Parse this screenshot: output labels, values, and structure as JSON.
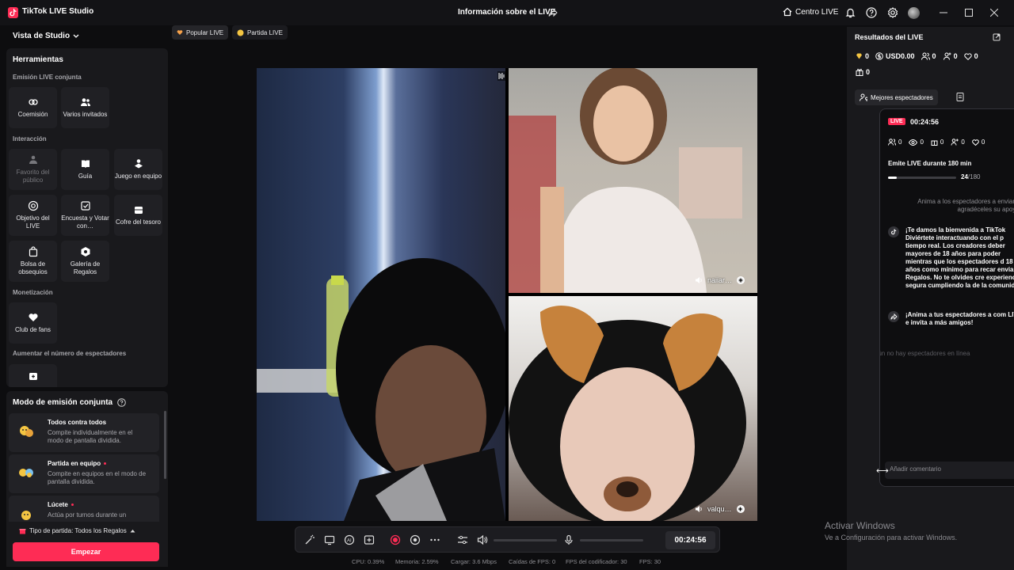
{
  "titlebar": {
    "app_title": "TikTok LIVE Studio",
    "window_title": "Información sobre el LIVE",
    "centro_label": "Centro LIVE"
  },
  "left": {
    "studio_view": "Vista de Studio",
    "tools_title": "Herramientas",
    "sections": {
      "joint": "Emisión LIVE conjunta",
      "interaction": "Interacción",
      "monetization": "Monetización",
      "viewers": "Aumentar el número de espectadores"
    },
    "tools": {
      "comision": "Coemisión",
      "varios": "Varios invitados",
      "favorito": "Favorito del público",
      "guia": "Guía",
      "juego": "Juego en equipo",
      "objetivo": "Objetivo del LIVE",
      "encuesta": "Encuesta y Votar con…",
      "cofre": "Cofre del tesoro",
      "bolsa": "Bolsa de obsequios",
      "galeria": "Galería de Regalos",
      "club": "Club de fans"
    },
    "mode_title": "Modo de emisión conjunta",
    "modes": [
      {
        "title": "Todos contra todos",
        "desc": "Compite individualmente en el modo de pantalla dividida."
      },
      {
        "title": "Partida en equipo",
        "desc": "Compite en equipos en el modo de pantalla dividida."
      },
      {
        "title": "Lúcete",
        "desc": "Actúa por turnos durante un"
      }
    ],
    "party_type": "Tipo de partida: Todos los Regalos",
    "start_button": "Empezar"
  },
  "center": {
    "chips": [
      "Popular LIVE",
      "Partida LIVE"
    ],
    "guests": [
      "naiiar…",
      "valqu…"
    ],
    "timer": "00:24:56",
    "stats": {
      "cpu": "CPU:  0.39%",
      "mem": "Memoria:  2.59%",
      "load": "Cargar:  3.6 Mbps",
      "drops": "Caídas de FPS:  0",
      "enc": "FPS del codificador:  30",
      "fps": "FPS:  30"
    }
  },
  "right": {
    "title": "Resultados del LIVE",
    "metrics": {
      "diamonds": "0",
      "usd": "USD0.00",
      "viewers": "0",
      "new_followers": "0",
      "likes": "0",
      "gifts": "0"
    },
    "best_viewers_tab": "Mejores espectadores",
    "popup": {
      "live_badge": "LIVE",
      "time": "00:24:56",
      "metrics": [
        "0",
        "0",
        "0",
        "0",
        "0"
      ],
      "goal": "Emite LIVE durante 180 min",
      "progress_value": "24",
      "progress_max": "/180",
      "progress_fraction": 0.133,
      "hint": "Anima a los espectadores a enviar R agradéceles su apoyo.",
      "msg1": "¡Te damos la bienvenida a TikTok Diviértete interactuando con el p tiempo real. Los creadores deber mayores de 18 años para poder mientras que los espectadores d 18 años como mínimo para recar enviar Regalos. No te olvides cre experiencia segura cumpliendo la de la comunidad.",
      "msg2": "¡Anima a tus espectadores a com LIVE e invita a más amigos!",
      "no_viewers": "Aún no hay espectadores en línea",
      "comment_placeholder": "Añadir comentario"
    }
  },
  "watermark": {
    "line1": "Activar Windows",
    "line2": "Ve a Configuración para activar Windows."
  },
  "colors": {
    "accent": "#fe2c55",
    "bg": "#0d0d0f",
    "panel": "#19191c"
  }
}
